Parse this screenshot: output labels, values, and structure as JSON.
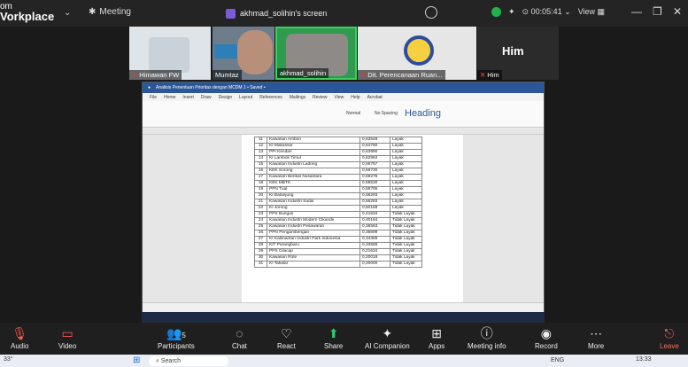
{
  "app": {
    "brand_line1": "om",
    "brand_line2": "Vorkplace",
    "meeting_label": "Meeting"
  },
  "screen_share": {
    "label": "akhmad_solihin's screen"
  },
  "topbar": {
    "timer": "00:05:41",
    "view_label": "View"
  },
  "tiles": [
    {
      "name": "Himawan FW"
    },
    {
      "name": "Mumtaz"
    },
    {
      "name": "akhmad_solihin"
    },
    {
      "name": "Dit. Perencanaan Ruan..."
    },
    {
      "name": "Him",
      "initials": "Him"
    }
  ],
  "word": {
    "title": "Analisis Penentuan Prioritas dengan MCDM 1 • Saved •",
    "tabs": [
      "File",
      "Home",
      "Insert",
      "Draw",
      "Design",
      "Layout",
      "References",
      "Mailings",
      "Review",
      "View",
      "Help",
      "Acrobat"
    ],
    "styles": {
      "normal": "Normal",
      "no_spacing": "No Spacing",
      "heading": "Heading"
    },
    "rows": [
      {
        "no": "11",
        "name": "Kawasan Ambon",
        "score": "0,63548",
        "status": "Layak"
      },
      {
        "no": "12",
        "name": "KI Makassar",
        "score": "0,64760",
        "status": "Layak"
      },
      {
        "no": "13",
        "name": "PPI Kendari",
        "score": "0,63990",
        "status": "Layak"
      },
      {
        "no": "14",
        "name": "KI Lambok Timur",
        "score": "0,62984",
        "status": "Layak"
      },
      {
        "no": "15",
        "name": "Kawasan Industri Ladong",
        "score": "0,59757",
        "status": "Layak"
      },
      {
        "no": "16",
        "name": "KEK Sorong",
        "score": "0,59730",
        "status": "Layak"
      },
      {
        "no": "17",
        "name": "Kawasan Berikat Nusantara",
        "score": "0,59276",
        "status": "Layak"
      },
      {
        "no": "18",
        "name": "KEK MBTK",
        "score": "0,58530",
        "status": "Layak"
      },
      {
        "no": "19",
        "name": "PPN Tual",
        "score": "0,58795",
        "status": "Layak"
      },
      {
        "no": "20",
        "name": "KI Batanjung",
        "score": "0,58293",
        "status": "Layak"
      },
      {
        "no": "21",
        "name": "Kawasan Industri Sadai",
        "score": "0,56283",
        "status": "Layak"
      },
      {
        "no": "22",
        "name": "KI Jorong",
        "score": "0,50168",
        "status": "Layak"
      },
      {
        "no": "23",
        "name": "PPS Bungus",
        "score": "0,41634",
        "status": "Tidak Layak"
      },
      {
        "no": "24",
        "name": "Kawasan Industri Modern Cikande",
        "score": "0,40184",
        "status": "Tidak Layak"
      },
      {
        "no": "25",
        "name": "Kawasan Industri Pesawaran",
        "score": "0,36563",
        "status": "Tidak Layak"
      },
      {
        "no": "26",
        "name": "PPN Pengambengan",
        "score": "0,35699",
        "status": "Tidak Layak"
      },
      {
        "no": "27",
        "name": "KI Kalimantan Industri Park Indonesia",
        "score": "0,34389",
        "status": "Tidak Layak"
      },
      {
        "no": "28",
        "name": "KIT Parangbaru",
        "score": "0,33586",
        "status": "Tidak Layak"
      },
      {
        "no": "29",
        "name": "PPS Cilacap",
        "score": "0,21634",
        "status": "Tidak Layak"
      },
      {
        "no": "30",
        "name": "Kawasan Rote",
        "score": "0,20018",
        "status": "Tidak Layak"
      },
      {
        "no": "31",
        "name": "KI Takalar",
        "score": "0,20000",
        "status": "Tidak Layak"
      }
    ]
  },
  "toolbar": {
    "audio": "Audio",
    "video": "Video",
    "participants": "Participants",
    "participants_count": "5",
    "chat": "Chat",
    "react": "React",
    "share": "Share",
    "ai": "AI Companion",
    "apps": "Apps",
    "meeting_info": "Meeting info",
    "record": "Record",
    "more": "More",
    "leave": "Leave"
  },
  "taskbar": {
    "temp": "33°",
    "search": "Search",
    "lang": "ENG",
    "time": "13:33"
  }
}
